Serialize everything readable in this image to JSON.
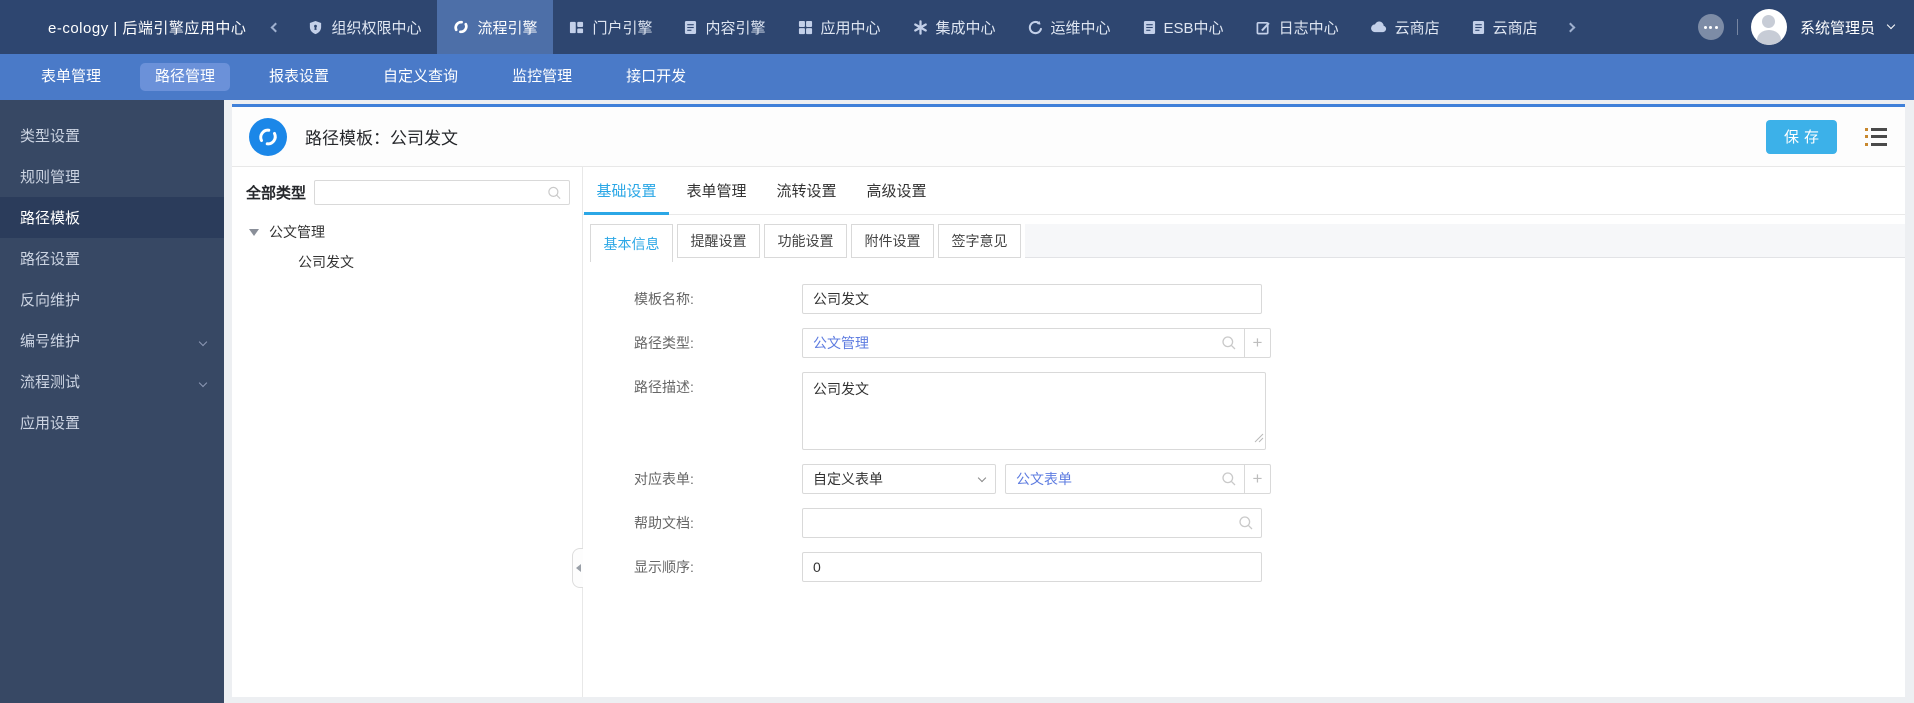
{
  "top_nav": {
    "brand": "e-cology | 后端引擎应用中心",
    "items": [
      {
        "label": "组织权限中心",
        "icon": "shield-icon",
        "selected": false
      },
      {
        "label": "流程引擎",
        "icon": "flow-icon",
        "selected": true
      },
      {
        "label": "门户引擎",
        "icon": "portal-grid-icon",
        "selected": false
      },
      {
        "label": "内容引擎",
        "icon": "document-icon",
        "selected": false
      },
      {
        "label": "应用中心",
        "icon": "apps-grid-icon",
        "selected": false
      },
      {
        "label": "集成中心",
        "icon": "integration-asterisk-icon",
        "selected": false
      },
      {
        "label": "运维中心",
        "icon": "ops-refresh-icon",
        "selected": false
      },
      {
        "label": "ESB中心",
        "icon": "document-icon",
        "selected": false
      },
      {
        "label": "日志中心",
        "icon": "log-edit-icon",
        "selected": false
      },
      {
        "label": "云商店",
        "icon": "cloud-icon",
        "selected": false
      },
      {
        "label": "云商店",
        "icon": "document-icon",
        "selected": false
      }
    ],
    "user_name": "系统管理员"
  },
  "sub_nav": {
    "items": [
      {
        "label": "表单管理",
        "selected": false
      },
      {
        "label": "路径管理",
        "selected": true
      },
      {
        "label": "报表设置",
        "selected": false
      },
      {
        "label": "自定义查询",
        "selected": false
      },
      {
        "label": "监控管理",
        "selected": false
      },
      {
        "label": "接口开发",
        "selected": false
      }
    ]
  },
  "sidebar": {
    "items": [
      {
        "label": "类型设置",
        "selected": false,
        "expandable": false
      },
      {
        "label": "规则管理",
        "selected": false,
        "expandable": false
      },
      {
        "label": "路径模板",
        "selected": true,
        "expandable": false
      },
      {
        "label": "路径设置",
        "selected": false,
        "expandable": false
      },
      {
        "label": "反向维护",
        "selected": false,
        "expandable": false
      },
      {
        "label": "编号维护",
        "selected": false,
        "expandable": true
      },
      {
        "label": "流程测试",
        "selected": false,
        "expandable": true
      },
      {
        "label": "应用设置",
        "selected": false,
        "expandable": false
      }
    ]
  },
  "page_header": {
    "title": "路径模板：公司发文",
    "save_label": "保存"
  },
  "tree_panel": {
    "title": "全部类型",
    "search_placeholder": "",
    "root_node": "公文管理",
    "child_node": "公司发文"
  },
  "tabs": {
    "primary": [
      {
        "label": "基础设置",
        "active": true
      },
      {
        "label": "表单管理",
        "active": false
      },
      {
        "label": "流转设置",
        "active": false
      },
      {
        "label": "高级设置",
        "active": false
      }
    ],
    "secondary": [
      {
        "label": "基本信息",
        "active": true
      },
      {
        "label": "提醒设置",
        "active": false
      },
      {
        "label": "功能设置",
        "active": false
      },
      {
        "label": "附件设置",
        "active": false
      },
      {
        "label": "签字意见",
        "active": false
      }
    ]
  },
  "form": {
    "template_name": {
      "label": "模板名称:",
      "value": "公司发文"
    },
    "path_type": {
      "label": "路径类型:",
      "value": "公文管理"
    },
    "path_desc": {
      "label": "路径描述:",
      "value": "公司发文"
    },
    "form_binding": {
      "label": "对应表单:",
      "select_value": "自定义表单",
      "value": "公文表单"
    },
    "help_doc": {
      "label": "帮助文档:",
      "value": ""
    },
    "display_order": {
      "label": "显示顺序:",
      "value": "0"
    }
  },
  "colors": {
    "topbar_bg": "#2e4670",
    "topbar_selected_bg": "#4d6fa8",
    "subbar_bg": "#4a7ac8",
    "subbar_selected_bg": "#6b91d9",
    "sidebar_bg": "#374864",
    "sidebar_selected_bg": "#2b3c5b",
    "card_accent_line": "#3f80d9",
    "module_badge_bg": "#1b87e8",
    "save_button_bg": "#3cb1e9",
    "active_tab_blue": "#2ba7e6",
    "link_value_blue": "#5e7ce0"
  }
}
